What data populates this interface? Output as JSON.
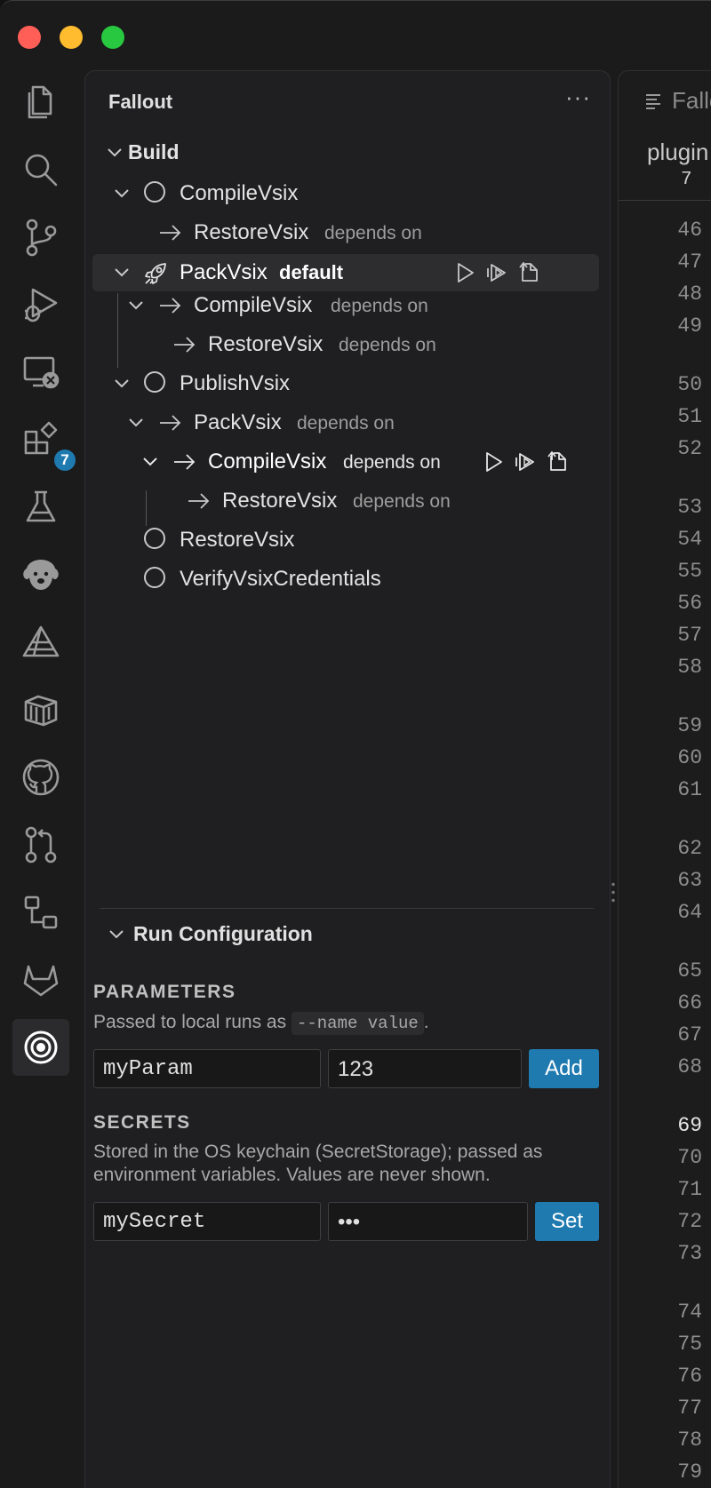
{
  "window": {
    "controls": [
      "close",
      "minimize",
      "zoom"
    ]
  },
  "activity_bar": {
    "items": [
      {
        "icon": "files-icon"
      },
      {
        "icon": "search-icon"
      },
      {
        "icon": "source-control-icon"
      },
      {
        "icon": "run-debug-icon"
      },
      {
        "icon": "remote-explorer-icon"
      },
      {
        "icon": "extensions-icon",
        "badge": "7"
      },
      {
        "icon": "testing-icon"
      },
      {
        "icon": "dog-icon"
      },
      {
        "icon": "triangle-icon"
      },
      {
        "icon": "container-icon"
      },
      {
        "icon": "github-icon"
      },
      {
        "icon": "pull-request-icon"
      },
      {
        "icon": "hierarchy-icon"
      },
      {
        "icon": "gitlab-icon"
      },
      {
        "icon": "target-icon",
        "active": true
      }
    ],
    "extensions_badge": "7"
  },
  "sidebar": {
    "title": "Fallout",
    "more_label": "···",
    "build_section": "Build",
    "tree": [
      {
        "label": "CompileVsix"
      },
      {
        "label": "RestoreVsix",
        "suffix": "depends on"
      },
      {
        "label": "PackVsix",
        "tag": "default"
      },
      {
        "label": "CompileVsix",
        "suffix": "depends on"
      },
      {
        "label": "RestoreVsix",
        "suffix": "depends on"
      },
      {
        "label": "PublishVsix"
      },
      {
        "label": "PackVsix",
        "suffix": "depends on"
      },
      {
        "label": "CompileVsix",
        "suffix": "depends on"
      },
      {
        "label": "RestoreVsix",
        "suffix": "depends on"
      },
      {
        "label": "RestoreVsix"
      },
      {
        "label": "VerifyVsixCredentials"
      }
    ],
    "run_config": {
      "title": "Run Configuration",
      "parameters": {
        "caption": "PARAMETERS",
        "help_prefix": "Passed to local runs as",
        "help_code": "--name value",
        "help_suffix": ".",
        "name_value": "myParam",
        "value_value": "123",
        "button": "Add"
      },
      "secrets": {
        "caption": "SECRETS",
        "help_line1": "Stored in the OS keychain (SecretStorage); passed as",
        "help_line2": "environment variables. Values are never shown.",
        "name_value": "mySecret",
        "value_value": "•••",
        "button": "Set"
      }
    }
  },
  "editor": {
    "tab_name": "Fallo",
    "breadcrumb": "plugin",
    "breadcrumb_line": "7",
    "line_numbers": [
      "46",
      "47",
      "48",
      "49",
      "50",
      "51",
      "52",
      "53",
      "54",
      "55",
      "56",
      "57",
      "58",
      "59",
      "60",
      "61",
      "62",
      "63",
      "64",
      "65",
      "66",
      "67",
      "68",
      "69",
      "70",
      "71",
      "72",
      "73",
      "74",
      "75",
      "76",
      "77",
      "78",
      "79"
    ],
    "current_line": "69"
  },
  "colors": {
    "accent": "#1f7ab0",
    "background": "#1f1f21",
    "text": "#e3e3e3",
    "muted": "#9d9d9d"
  }
}
